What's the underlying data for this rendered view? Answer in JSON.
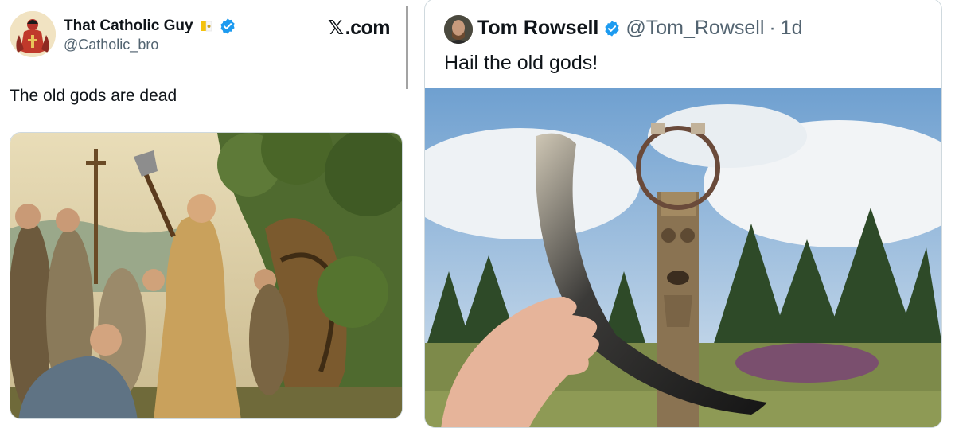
{
  "left_tweet": {
    "display_name": "That Catholic Guy",
    "handle": "@Catholic_bro",
    "text": "The old gods are dead",
    "source_label": ".com",
    "source_mark": "𝕏",
    "badge_icon": "vatican-flag-icon",
    "verified_icon": "verified-badge-icon"
  },
  "right_tweet": {
    "display_name": "Tom Rowsell",
    "handle": "@Tom_Rowsell",
    "separator": "·",
    "time": "1d",
    "text": "Hail the old gods!",
    "verified_icon": "verified-badge-icon"
  },
  "colors": {
    "verified_blue": "#1d9bf0",
    "muted_text": "#536471",
    "border": "#cfd9de"
  }
}
